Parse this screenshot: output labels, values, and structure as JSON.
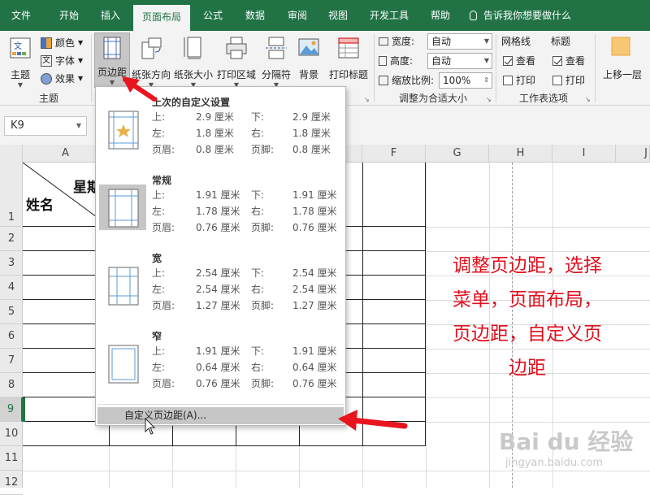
{
  "tabs": [
    "文件",
    "开始",
    "插入",
    "页面布局",
    "公式",
    "数据",
    "审阅",
    "视图",
    "开发工具",
    "帮助"
  ],
  "tell_me": "告诉我你想要做什么",
  "theme_group": {
    "themes_label": "主题",
    "colors_label": "颜色",
    "fonts_label": "字体",
    "effects_label": "效果",
    "group_label": "主题"
  },
  "page_setup": {
    "margins": "页边距",
    "orientation": "纸张方向",
    "size": "纸张大小",
    "print_area": "打印区域",
    "breaks": "分隔符",
    "background": "背景",
    "print_titles": "打印标题"
  },
  "scale_fit": {
    "width_label": "宽度:",
    "width_value": "自动",
    "height_label": "高度:",
    "height_value": "自动",
    "scale_label": "缩放比例:",
    "scale_value": "100%",
    "group_label": "调整为合适大小"
  },
  "sheet_options": {
    "gridlines": "网格线",
    "headings": "标题",
    "view": "查看",
    "print": "打印",
    "group_label": "工作表选项",
    "gridlines_view": true,
    "gridlines_print": false,
    "headings_view": true,
    "headings_print": false
  },
  "arrange": {
    "bring_forward": "上移一层"
  },
  "name_box": "K9",
  "columns": [
    "A",
    "",
    "",
    "",
    "",
    "F",
    "G",
    "H",
    "I",
    "J"
  ],
  "rows": [
    "1",
    "2",
    "3",
    "4",
    "5",
    "6",
    "7",
    "8",
    "9",
    "10",
    "11",
    "12"
  ],
  "cells": {
    "a1_top": "星期",
    "a1_bottom": "姓名"
  },
  "dropdown": {
    "options": [
      {
        "title": "上次的自定义设置",
        "top": "2.9 厘米",
        "bottom": "2.9 厘米",
        "left": "1.8 厘米",
        "right": "1.8 厘米",
        "header": "0.8 厘米",
        "footer": "0.8 厘米"
      },
      {
        "title": "常规",
        "top": "1.91 厘米",
        "bottom": "1.91 厘米",
        "left": "1.78 厘米",
        "right": "1.78 厘米",
        "header": "0.76 厘米",
        "footer": "0.76 厘米"
      },
      {
        "title": "宽",
        "top": "2.54 厘米",
        "bottom": "2.54 厘米",
        "left": "2.54 厘米",
        "right": "2.54 厘米",
        "header": "1.27 厘米",
        "footer": "1.27 厘米"
      },
      {
        "title": "窄",
        "top": "1.91 厘米",
        "bottom": "1.91 厘米",
        "left": "0.64 厘米",
        "right": "0.64 厘米",
        "header": "0.76 厘米",
        "footer": "0.76 厘米"
      }
    ],
    "labels": {
      "top": "上:",
      "bottom": "下:",
      "left": "左:",
      "right": "右:",
      "header": "页眉:",
      "footer": "页脚:"
    },
    "custom": "自定义页边距(A)..."
  },
  "annotation": [
    "调整页边距，选择",
    "菜单，页面布局，",
    "页边距，自定义页",
    "边距"
  ],
  "watermark": {
    "brand": "Bai du 经验",
    "url": "jingyan.baidu.com"
  },
  "colors": {
    "ribbon_green": "#217346",
    "annotation_red": "#e0101e",
    "arrow_red": "#e8151f"
  }
}
